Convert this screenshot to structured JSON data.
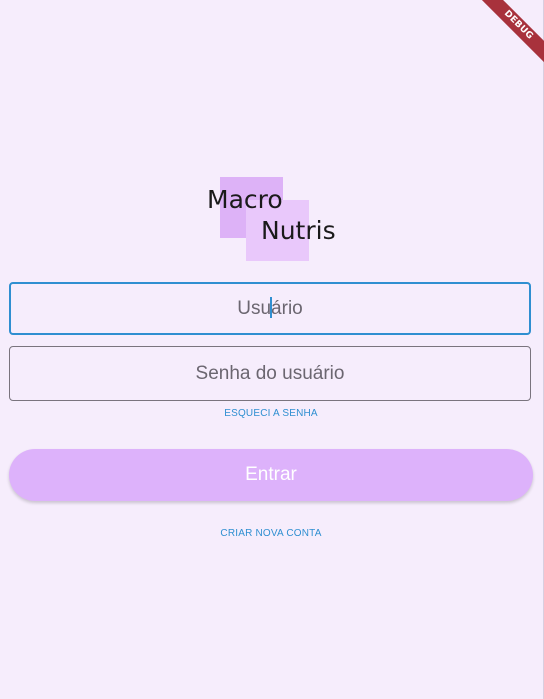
{
  "debug_banner": "DEBUG",
  "logo": {
    "line1": "Macro",
    "line2": "Nutris"
  },
  "login": {
    "username_placeholder_before_caret": "Usu",
    "username_placeholder_after_caret": "ário",
    "password_placeholder": "Senha do usuário",
    "forgot_password_label": "ESQUECI A SENHA",
    "submit_label": "Entrar",
    "create_account_label": "CRIAR NOVA CONTA"
  },
  "colors": {
    "background": "#f6edfc",
    "accent": "#2f8fd1",
    "primary_button": "#ddb2fb",
    "logo_square_dark": "#ddb2f7",
    "logo_square_light": "#e9c8fb",
    "debug_ribbon": "#a8323c"
  }
}
